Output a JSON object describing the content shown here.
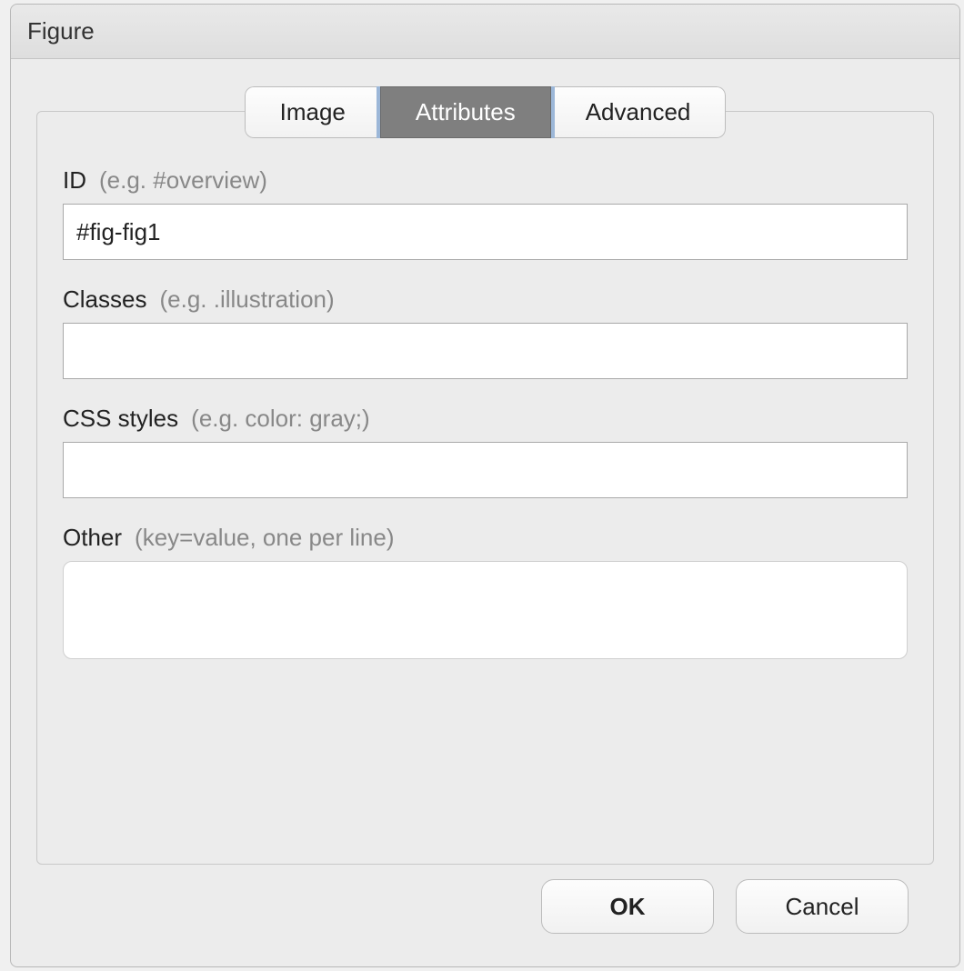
{
  "dialog": {
    "title": "Figure"
  },
  "tabs": {
    "image": "Image",
    "attributes": "Attributes",
    "advanced": "Advanced"
  },
  "fields": {
    "id": {
      "label": "ID",
      "hint": "(e.g. #overview)",
      "value": "#fig-fig1"
    },
    "classes": {
      "label": "Classes",
      "hint": "(e.g. .illustration)",
      "value": ""
    },
    "css": {
      "label": "CSS styles",
      "hint": "(e.g. color: gray;)",
      "value": ""
    },
    "other": {
      "label": "Other",
      "hint": "(key=value, one per line)",
      "value": ""
    }
  },
  "buttons": {
    "ok": "OK",
    "cancel": "Cancel"
  }
}
